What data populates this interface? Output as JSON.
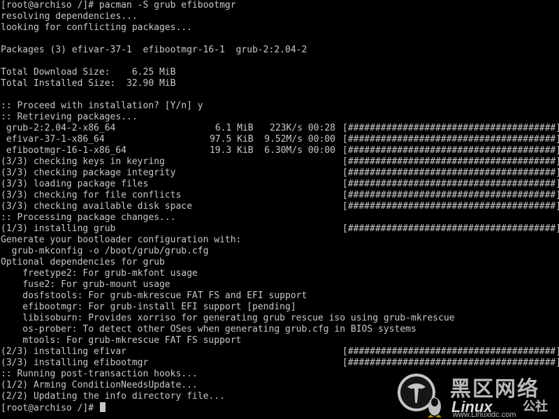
{
  "terminal": {
    "lines": [
      "[root@archiso /]# pacman -S grub efibootmgr",
      "resolving dependencies...",
      "looking for conflicting packages...",
      "",
      "Packages (3) efivar-37-1  efibootmgr-16-1  grub-2:2.04-2",
      "",
      "Total Download Size:    6.25 MiB",
      "Total Installed Size:  32.90 MiB",
      "",
      ":: Proceed with installation? [Y/n] y",
      ":: Retrieving packages...",
      {
        "left": " grub-2:2.04-2-x86_64",
        "mid": "6.1 MiB   223K/s 00:28",
        "bar": "[######################################] 100%"
      },
      {
        "left": " efivar-37-1-x86_64",
        "mid": "97.5 KiB  9.52M/s 00:00",
        "bar": "[######################################] 100%"
      },
      {
        "left": " efibootmgr-16-1-x86_64",
        "mid": "19.3 KiB  6.30M/s 00:00",
        "bar": "[######################################] 100%"
      },
      {
        "left": "(3/3) checking keys in keyring",
        "mid": "",
        "bar": "[######################################] 100%"
      },
      {
        "left": "(3/3) checking package integrity",
        "mid": "",
        "bar": "[######################################] 100%"
      },
      {
        "left": "(3/3) loading package files",
        "mid": "",
        "bar": "[######################################] 100%"
      },
      {
        "left": "(3/3) checking for file conflicts",
        "mid": "",
        "bar": "[######################################] 100%"
      },
      {
        "left": "(3/3) checking available disk space",
        "mid": "",
        "bar": "[######################################] 100%"
      },
      ":: Processing package changes...",
      {
        "left": "(1/3) installing grub",
        "mid": "",
        "bar": "[######################################] 100%"
      },
      "Generate your bootloader configuration with:",
      "  grub-mkconfig -o /boot/grub/grub.cfg",
      "Optional dependencies for grub",
      "    freetype2: For grub-mkfont usage",
      "    fuse2: For grub-mount usage",
      "    dosfstools: For grub-mkrescue FAT FS and EFI support",
      "    efibootmgr: For grub-install EFI support [pending]",
      "    libisoburn: Provides xorriso for generating grub rescue iso using grub-mkrescue",
      "    os-prober: To detect other OSes when generating grub.cfg in BIOS systems",
      "    mtools: For grub-mkrescue FAT FS support",
      {
        "left": "(2/3) installing efivar",
        "mid": "",
        "bar": "[######################################] 100%"
      },
      {
        "left": "(3/3) installing efibootmgr",
        "mid": "",
        "bar": "[######################################] 100%"
      },
      ":: Running post-transaction hooks...",
      "(1/2) Arming ConditionNeedsUpdate...",
      "(2/2) Updating the info directory file...",
      "[root@archiso /]# "
    ]
  },
  "watermark": {
    "cn": "黑区网络",
    "linux": "Linux",
    "gongshe": "公社",
    "url": "www.Linuxidc.com"
  },
  "colors": {
    "background": "#000000",
    "text": "#c8c8c8"
  }
}
